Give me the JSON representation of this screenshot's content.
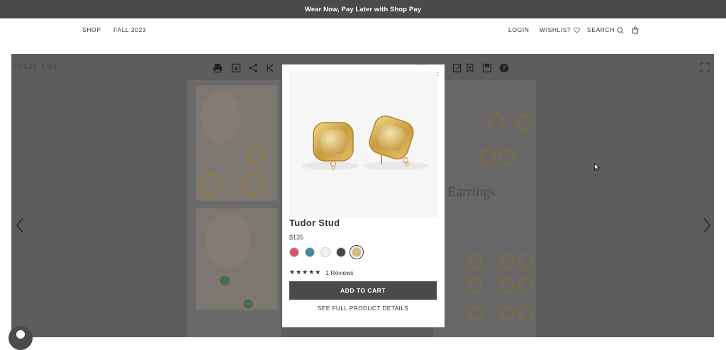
{
  "promo_bar": {
    "text": "Wear Now, Pay Later with Shop Pay"
  },
  "nav": {
    "left": [
      "SHOP",
      "FALL 2023"
    ],
    "login": "LOGIN",
    "wishlist": "WISHLIST",
    "search": "SEARCH"
  },
  "viewer": {
    "brand": "JULIE VOS",
    "toolbar_icons": [
      "print-icon",
      "download-icon",
      "share-icon",
      "first-page-icon",
      "edit-icon",
      "bookmark-add-icon",
      "bookmark-icon",
      "help-icon"
    ],
    "catalog_heading": "n Earrings",
    "catalog_subheading": "--- --- ---- ---"
  },
  "quick_view": {
    "product_name": "Tudor Stud",
    "price": "$135",
    "swatches": [
      {
        "name": "pink",
        "color": "#d9556f"
      },
      {
        "name": "teal",
        "color": "#3f8a9a"
      },
      {
        "name": "white",
        "color": "#f0f0f0"
      },
      {
        "name": "charcoal",
        "color": "#474747"
      },
      {
        "name": "gold",
        "color": "#d7bd7a",
        "selected": true
      }
    ],
    "stars": "★★★★★",
    "reviews": "1 Reviews",
    "add_to_cart": "ADD TO CART",
    "details_link": "SEE FULL PRODUCT DETAILS",
    "close": "×"
  },
  "colors": {
    "promo_bg": "#4a4a4a",
    "overlay": "#5d5d5d",
    "button_bg": "#4a4a4a",
    "gold": "#c9a24a"
  }
}
